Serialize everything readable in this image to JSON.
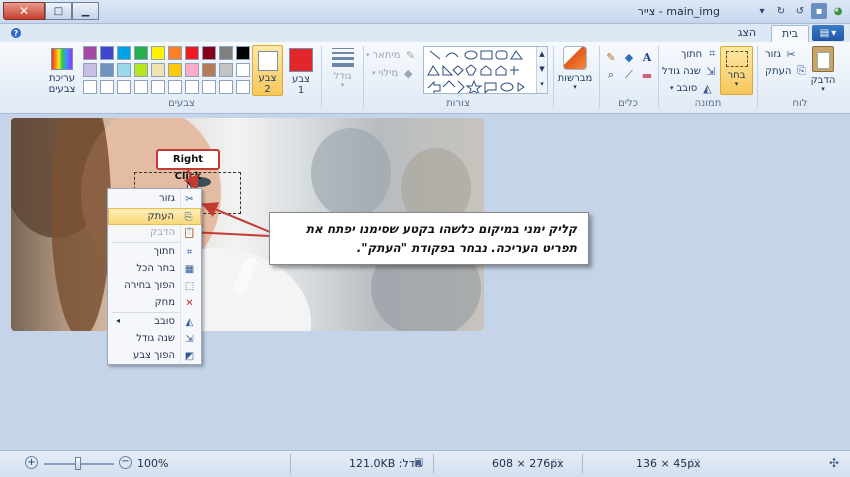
{
  "window": {
    "title": "צייר - main_img",
    "minimize": "▁",
    "maximize": "□",
    "close": "✕"
  },
  "tabs": {
    "file": "▤",
    "home": "בית",
    "view": "הצג"
  },
  "ribbon": {
    "clipboard": {
      "label": "לוח",
      "paste": "הדבק",
      "cut": "גזור",
      "copy": "העתק"
    },
    "image": {
      "label": "תמונה",
      "select": "בחר",
      "crop": "חתוך",
      "resize": "שנה גודל",
      "rotate": "סובב"
    },
    "tools": {
      "label": "כלים"
    },
    "brushes": {
      "label": "מברשות"
    },
    "shapes": {
      "label": "צורות",
      "outline": "מיתאר",
      "fill": "מילוי"
    },
    "size": {
      "label": "גודל"
    },
    "colors": {
      "label": "צבעים",
      "color1": "צבע\n1",
      "color2": "צבע\n2",
      "edit": "עריכת צבעים",
      "color1_hex": "#e3262a",
      "color2_hex": "#ffffff",
      "palette": [
        "#000000",
        "#7f7f7f",
        "#880015",
        "#ed1c24",
        "#ff7f27",
        "#fff200",
        "#22b14c",
        "#00a2e8",
        "#3f48cc",
        "#a349a4",
        "#ffffff",
        "#c3c3c3",
        "#b97a57",
        "#ffaec9",
        "#ffc90e",
        "#efe4b0",
        "#b5e61d",
        "#99d9ea",
        "#7092be",
        "#c8bfe7",
        "#ffffff",
        "#ffffff",
        "#ffffff",
        "#ffffff",
        "#ffffff",
        "#ffffff",
        "#ffffff",
        "#ffffff",
        "#ffffff",
        "#ffffff"
      ]
    }
  },
  "callout": "Right Click",
  "note": "קליק ימני במיקום כלשהו בקטע שסימנו יפתח את תפריט העריכה.   נבחר בפקודת \"העתק\".",
  "context_menu": [
    {
      "label": "גזור",
      "icon": "scissors-icon",
      "glyph": "✂",
      "state": "normal"
    },
    {
      "label": "העתק",
      "icon": "copy-icon",
      "glyph": "⎘",
      "state": "highlighted"
    },
    {
      "label": "הדבק",
      "icon": "paste-icon",
      "glyph": "📋",
      "state": "disabled"
    },
    {
      "label": "חתוך",
      "icon": "crop-icon",
      "glyph": "⌗",
      "state": "normal"
    },
    {
      "label": "בחר הכל",
      "icon": "select-all-icon",
      "glyph": "▦",
      "state": "normal"
    },
    {
      "label": "הפוך בחירה",
      "icon": "invert-selection-icon",
      "glyph": "⬚",
      "state": "normal"
    },
    {
      "label": "מחק",
      "icon": "delete-icon",
      "glyph": "✕",
      "state": "normal"
    },
    {
      "label": "סובב",
      "icon": "rotate-icon",
      "glyph": "◭",
      "state": "normal"
    },
    {
      "label": "שנה גודל",
      "icon": "resize-icon",
      "glyph": "⇲",
      "state": "normal"
    },
    {
      "label": "הפוך צבע",
      "icon": "invert-color-icon",
      "glyph": "◩",
      "state": "normal"
    }
  ],
  "status": {
    "selection_size": "136 × 45px",
    "image_size": "608 × 276px",
    "file_size": "גודל: 121.0KB",
    "zoom": "100%"
  }
}
